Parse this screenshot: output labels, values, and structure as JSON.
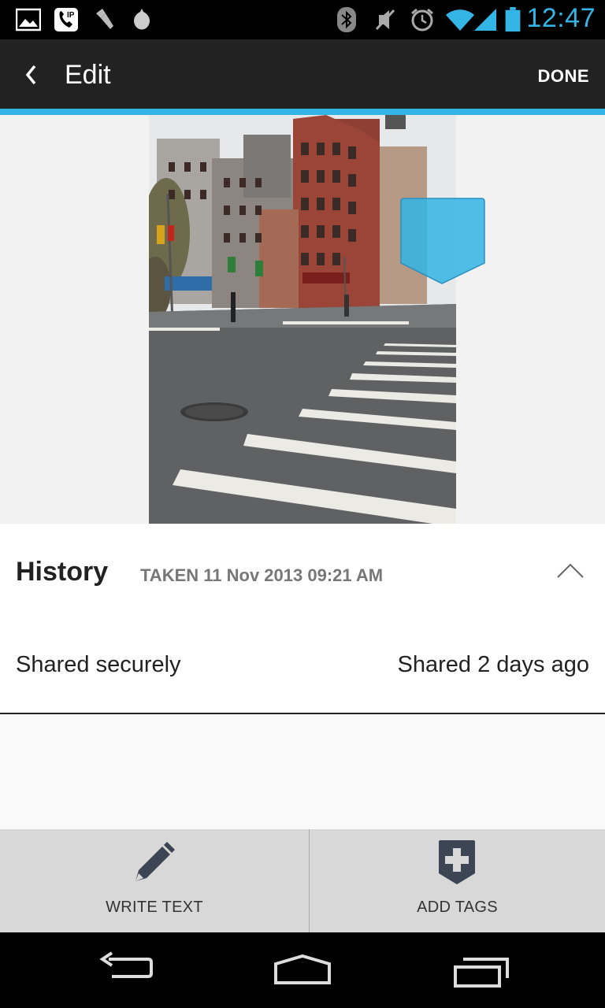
{
  "status_bar": {
    "time": "12:47",
    "left_icons": [
      "gallery-icon",
      "sip-call-icon",
      "flashlight-icon",
      "app-drop-icon"
    ],
    "right_icons": [
      "bluetooth-icon",
      "mute-icon",
      "alarm-icon",
      "wifi-icon",
      "signal-icon",
      "battery-icon"
    ],
    "accent_color": "#33b5e5"
  },
  "action_bar": {
    "title": "Edit",
    "done_label": "DONE",
    "back_icon": "chevron-left-icon"
  },
  "photo": {
    "description_icon": "street-photo",
    "tag_marker_icon": "tag-marker-icon"
  },
  "history": {
    "title": "History",
    "taken": "TAKEN 11 Nov 2013 09:21 AM",
    "collapse_icon": "chevron-up-icon",
    "shared_status": "Shared securely",
    "shared_when": "Shared 2 days ago"
  },
  "bottom_actions": {
    "write_text_label": "WRITE TEXT",
    "write_text_icon": "pencil-icon",
    "add_tags_label": "ADD TAGS",
    "add_tags_icon": "tag-plus-icon"
  },
  "nav_bar": {
    "icons": [
      "back-nav-icon",
      "home-nav-icon",
      "recents-nav-icon"
    ]
  }
}
